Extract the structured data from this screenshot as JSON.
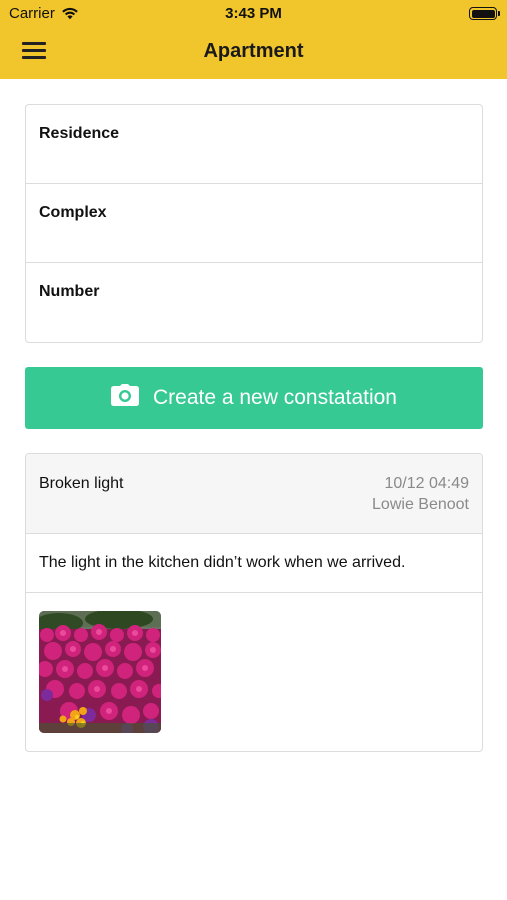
{
  "status_bar": {
    "carrier": "Carrier",
    "time": "3:43 PM"
  },
  "nav": {
    "title": "Apartment",
    "menu_icon": "hamburger-menu-icon"
  },
  "info": {
    "rows": [
      {
        "label": "Residence"
      },
      {
        "label": "Complex"
      },
      {
        "label": "Number"
      }
    ]
  },
  "create_button": {
    "label": "Create a new constatation",
    "icon": "camera-icon",
    "color": "#37c994"
  },
  "constatation": {
    "title": "Broken light",
    "date": "10/12 04:49",
    "author": "Lowie Benoot",
    "description": "The light in the kitchen didn’t work when we arrived.",
    "photo": "flowers-photo"
  },
  "colors": {
    "header": "#f1c52c",
    "accent_green": "#37c994",
    "muted_text": "#8a8a8a"
  }
}
